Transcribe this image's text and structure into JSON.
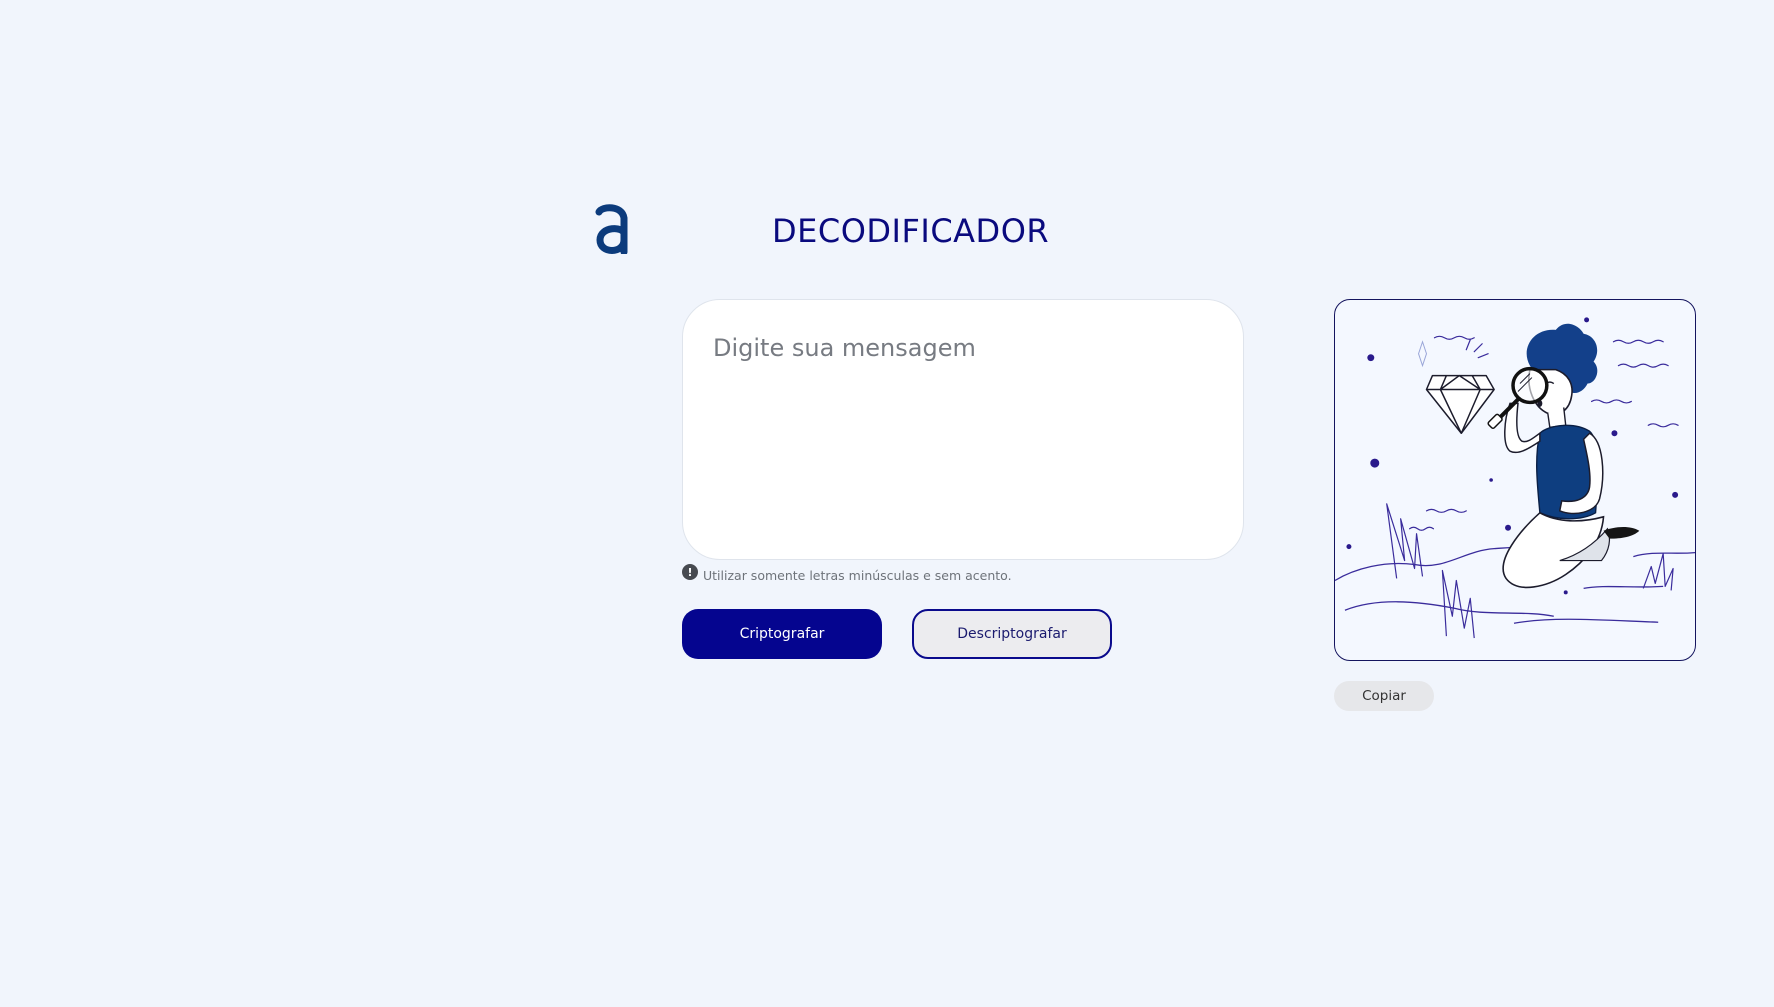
{
  "header": {
    "logo_icon": "alura-a-logo",
    "title": "DECODIFICADOR"
  },
  "input": {
    "placeholder": "Digite sua mensagem",
    "value": ""
  },
  "hint": {
    "icon": "exclamation-circle-icon",
    "text": "Utilizar somente letras minúsculas e sem acento."
  },
  "buttons": {
    "encrypt_label": "Criptografar",
    "decrypt_label": "Descriptografar",
    "copy_label": "Copiar"
  },
  "output": {
    "illustration": "person-with-magnifying-glass-illustration"
  },
  "colors": {
    "background": "#f1f5fc",
    "primary": "#05058f",
    "title": "#0a0a7e",
    "logo": "#0c3b7c",
    "panel_border": "#14145e",
    "accent_shirt": "#0e3e80",
    "decor_dot": "#2a1a8c"
  }
}
